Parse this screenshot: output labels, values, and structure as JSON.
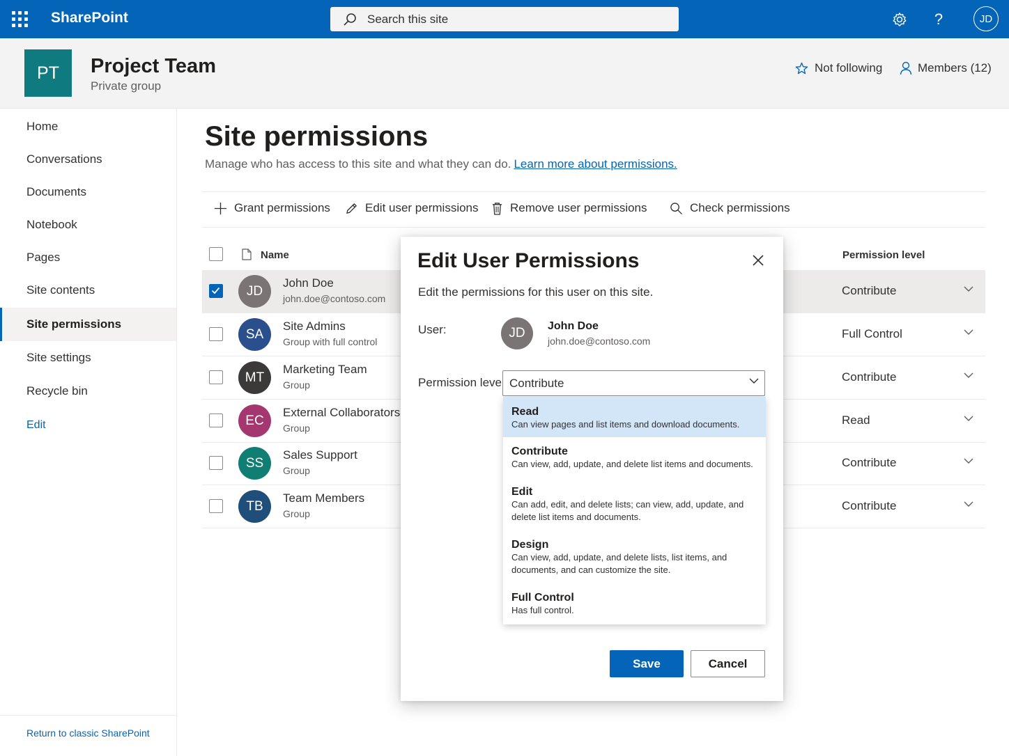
{
  "suitebar": {
    "brand": "SharePoint",
    "search_placeholder": "Search this site",
    "me_initials": "JD",
    "icons": [
      "waffle-icon",
      "search-icon",
      "gear-icon",
      "help-icon"
    ],
    "accent": "#0364b8"
  },
  "site": {
    "logo": "PT",
    "logo_color": "#0f7b80",
    "title": "Project Team",
    "subtitle": "Private group",
    "follow": "Not following",
    "members": "Members (12)"
  },
  "nav": {
    "items": [
      {
        "label": "Home"
      },
      {
        "label": "Conversations"
      },
      {
        "label": "Documents"
      },
      {
        "label": "Notebook"
      },
      {
        "label": "Pages"
      },
      {
        "label": "Site contents"
      },
      {
        "label": "Site permissions",
        "selected": true
      },
      {
        "label": "Site settings"
      },
      {
        "label": "Recycle bin"
      }
    ],
    "edit": "Edit",
    "classic": "Return to classic SharePoint"
  },
  "main": {
    "title": "Site permissions",
    "description": "Manage who has access to this site and what they can do.",
    "learn_more": "Learn more about permissions.",
    "commands": {
      "grant": "Grant permissions",
      "edit": "Edit user permissions",
      "remove": "Remove user permissions",
      "check": "Check permissions"
    },
    "columns": {
      "name": "Name",
      "permission": "Permission level"
    },
    "rows": [
      {
        "initials": "JD",
        "color": "#7a7574",
        "name": "John Doe",
        "sub": "john.doe@contoso.com",
        "permission": "Contribute",
        "selected": true
      },
      {
        "initials": "SA",
        "color": "#2b4f8c",
        "name": "Site Admins",
        "sub": "Group with full control",
        "permission": "Full Control",
        "selected": false
      },
      {
        "initials": "MT",
        "color": "#3b3a39",
        "name": "Marketing Team",
        "sub": "Group",
        "permission": "Contribute",
        "selected": false
      },
      {
        "initials": "EC",
        "color": "#a4376f",
        "name": "External Collaborators",
        "sub": "Group",
        "permission": "Read",
        "selected": false
      },
      {
        "initials": "SS",
        "color": "#117e74",
        "name": "Sales Support",
        "sub": "Group",
        "permission": "Contribute",
        "selected": false
      },
      {
        "initials": "TB",
        "color": "#1e4e79",
        "name": "Team Members",
        "sub": "Group",
        "permission": "Contribute",
        "selected": false
      }
    ]
  },
  "dialog": {
    "title": "Edit User Permissions",
    "description": "Edit the permissions for this user on this site.",
    "user_label": "User:",
    "user": {
      "initials": "JD",
      "name": "John Doe",
      "email": "john.doe@contoso.com"
    },
    "permission_label": "Permission level:",
    "selected_value": "Contribute",
    "options": [
      {
        "title": "Read",
        "desc": "Can view pages and list items and download documents.",
        "highlighted": true
      },
      {
        "title": "Contribute",
        "desc": "Can view, add, update, and delete list items and documents."
      },
      {
        "title": "Edit",
        "desc": "Can add, edit, and delete lists; can view, add, update, and delete list items and documents."
      },
      {
        "title": "Design",
        "desc": "Can view, add, update, and delete lists, list items, and documents, and can customize the site."
      },
      {
        "title": "Full Control",
        "desc": "Has full control."
      }
    ],
    "save": "Save",
    "cancel": "Cancel"
  }
}
